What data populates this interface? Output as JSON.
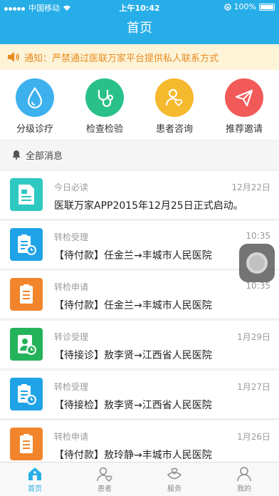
{
  "status_bar": {
    "carrier": "中国移动",
    "time": "上午10:42",
    "battery": "100%"
  },
  "nav": {
    "title": "首页"
  },
  "notice": {
    "text": "通知：严禁通过医联万家平台提供私人联系方式",
    "color": "#e88b22"
  },
  "quick_actions": [
    {
      "label": "分级诊疗",
      "icon": "water-drop-icon",
      "color": "#3db1ee"
    },
    {
      "label": "检查检验",
      "icon": "stethoscope-icon",
      "color": "#29c08a"
    },
    {
      "label": "患者咨询",
      "icon": "patient-heart-icon",
      "color": "#f5b92d"
    },
    {
      "label": "推荐邀请",
      "icon": "paper-plane-icon",
      "color": "#f25a5a"
    }
  ],
  "section": {
    "title": "全部消息"
  },
  "messages": [
    {
      "category": "今日必读",
      "date": "12月22日",
      "text": "医联万家APP2015年12月25日正式启动。",
      "icon": "document-icon",
      "color": "#2dc8c0"
    },
    {
      "category": "转检受理",
      "date": "10:35",
      "text": "【待付款】任金兰→丰城市人民医院",
      "icon": "clipboard-clock-icon",
      "color": "#1fa3e6"
    },
    {
      "category": "转检申请",
      "date": "10:35",
      "text": "【待付款】任金兰→丰城市人民医院",
      "icon": "clipboard-icon",
      "color": "#f2852c"
    },
    {
      "category": "转诊受理",
      "date": "1月29日",
      "text": "【待接诊】敖李贤→江西省人民医院",
      "icon": "person-clock-icon",
      "color": "#24b35a"
    },
    {
      "category": "转检受理",
      "date": "1月27日",
      "text": "【待接检】敖李贤→江西省人民医院",
      "icon": "clipboard-clock-icon",
      "color": "#1fa3e6"
    },
    {
      "category": "转检申请",
      "date": "1月26日",
      "text": "【待付款】敖玲静→丰城市人民医院",
      "icon": "clipboard-icon",
      "color": "#f2852c"
    }
  ],
  "tabs": [
    {
      "label": "首页",
      "icon": "home-icon",
      "active": true
    },
    {
      "label": "患者",
      "icon": "patient-icon",
      "active": false
    },
    {
      "label": "服务",
      "icon": "service-icon",
      "active": false
    },
    {
      "label": "我的",
      "icon": "profile-icon",
      "active": false
    }
  ],
  "accent": "#27aee8"
}
